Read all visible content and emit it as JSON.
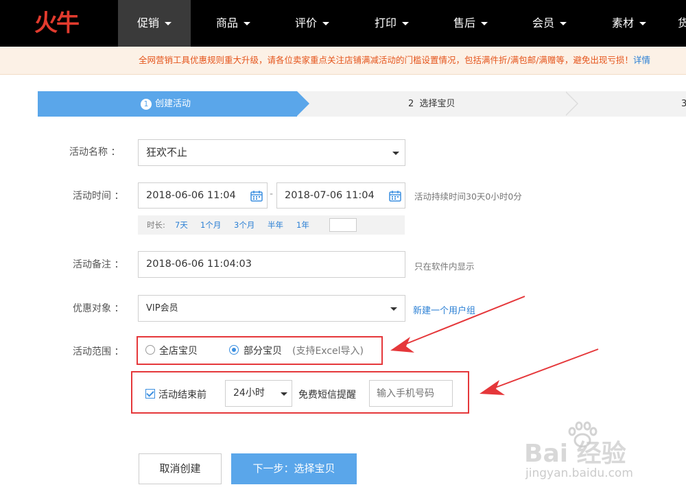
{
  "logo": {
    "text": "火牛"
  },
  "nav": {
    "items": [
      {
        "label": "促销",
        "active": true
      },
      {
        "label": "商品"
      },
      {
        "label": "评价"
      },
      {
        "label": "打印"
      },
      {
        "label": "售后"
      },
      {
        "label": "会员"
      },
      {
        "label": "素材"
      },
      {
        "label": "货"
      }
    ]
  },
  "notice": {
    "text": "全网营销工具优惠规则重大升级，请各位卖家重点关注店铺满减活动的门槛设置情况，包括满件折/满包邮/满赠等，避免出现亏损！",
    "link": "详情"
  },
  "steps": [
    {
      "num": "1",
      "label": "创建活动"
    },
    {
      "num": "2",
      "label": "选择宝贝"
    },
    {
      "num": "3",
      "label": ""
    }
  ],
  "form": {
    "name_label": "活动名称 ：",
    "name_value": "狂欢不止",
    "time_label": "活动时间 ：",
    "start_time": "2018-06-06 11:04",
    "time_sep": "-",
    "end_time": "2018-07-06 11:04",
    "duration_text": "活动持续时间30天0小时0分",
    "quick": {
      "prefix": "时长:",
      "options": [
        "7天",
        "1个月",
        "3个月",
        "半年",
        "1年"
      ]
    },
    "note_label": "活动备注 ：",
    "note_value": "2018-06-06 11:04:03",
    "note_hint": "只在软件内显示",
    "target_label": "优惠对象 ：",
    "target_value": "VIP会员",
    "target_link": "新建一个用户组",
    "scope_label": "活动范围 ：",
    "scope_all": "全店宝贝",
    "scope_part": "部分宝贝",
    "scope_note": "(支持Excel导入)",
    "scope_selected": "part",
    "remind_checkbox_label": "活动结束前",
    "remind_checked": true,
    "remind_time": "24小时",
    "remind_text": "免费短信提醒",
    "phone_placeholder": "输入手机号码"
  },
  "buttons": {
    "cancel": "取消创建",
    "next": "下一步：选择宝贝"
  },
  "watermark": {
    "line1": "Bai 经验",
    "line2": "jingyan.baidu.com"
  },
  "colors": {
    "accent": "#5aa6ea",
    "highlight_red": "#e5373a",
    "notice_text": "#e5551c",
    "link": "#2a7fd4"
  }
}
